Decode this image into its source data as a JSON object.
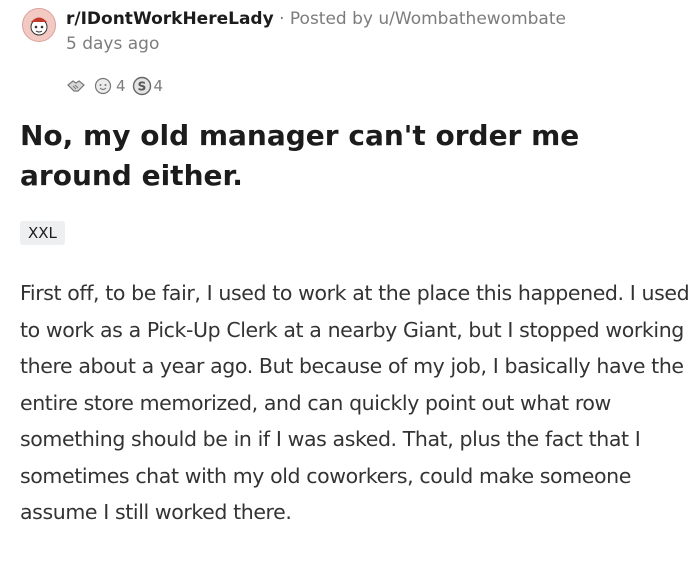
{
  "post": {
    "subreddit": "r/IDontWorkHereLady",
    "separator": "·",
    "posted_by": "Posted by",
    "author": "u/Wombathewombate",
    "timestamp": "5 days ago",
    "awards": [
      {
        "icon": "handshake-award-icon",
        "count": ""
      },
      {
        "icon": "wholesome-award-icon",
        "count": "4"
      },
      {
        "icon": "silver-award-icon",
        "count": "4"
      }
    ],
    "title": "No, my old manager can't order me around either.",
    "flair": "XXL",
    "body": "First off, to be fair, I used to work at the place this happened. I used to work as a Pick-Up Clerk at a nearby Giant, but I stopped working there about a year ago. But because of my job, I basically have the entire store memorized, and can quickly point out what row something should be in if I was asked. That, plus the fact that I sometimes chat with my old coworkers, could make someone assume I still worked there."
  }
}
